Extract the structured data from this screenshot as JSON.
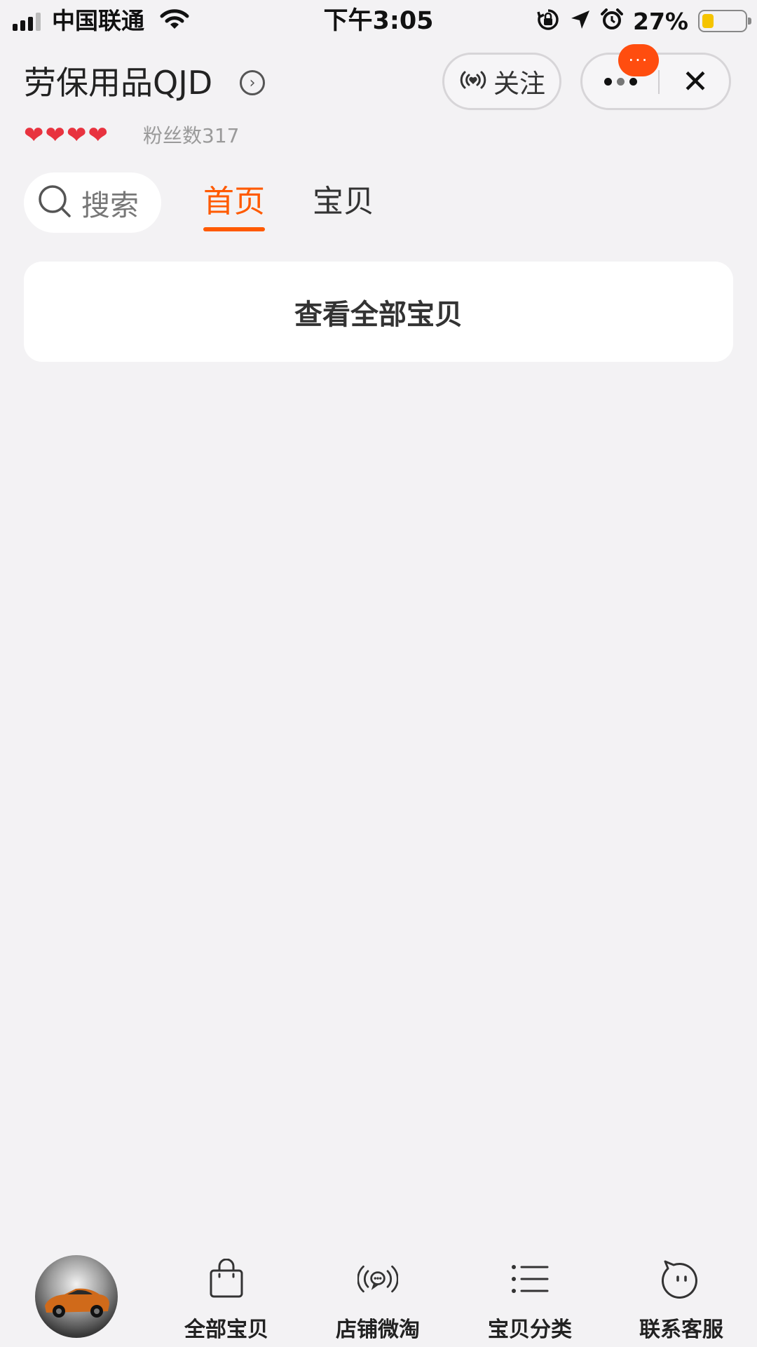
{
  "status_bar": {
    "carrier": "中国联通",
    "time": "下午3:05",
    "battery": "27%",
    "battery_level": 0.27,
    "battery_color": "#f5c400"
  },
  "header": {
    "shop_name": "劳保用品QJD",
    "follow_label": "关注",
    "fans": "粉丝数317",
    "badge": "···",
    "rating_hearts": 4
  },
  "nav": {
    "search_label": "搜索",
    "tabs": [
      {
        "label": "首页",
        "active": true
      },
      {
        "label": "宝贝",
        "active": false
      }
    ]
  },
  "main": {
    "view_all_label": "查看全部宝贝"
  },
  "bottom_bar": {
    "items": [
      {
        "label": "全部宝贝",
        "icon": "shopping-bag-icon"
      },
      {
        "label": "店铺微淘",
        "icon": "broadcast-chat-icon"
      },
      {
        "label": "宝贝分类",
        "icon": "category-list-icon"
      },
      {
        "label": "联系客服",
        "icon": "service-face-icon"
      }
    ]
  },
  "colors": {
    "accent": "#ff5a00",
    "badge": "#ff4d0f",
    "heart": "#e8333f",
    "background": "#f3f2f4"
  }
}
